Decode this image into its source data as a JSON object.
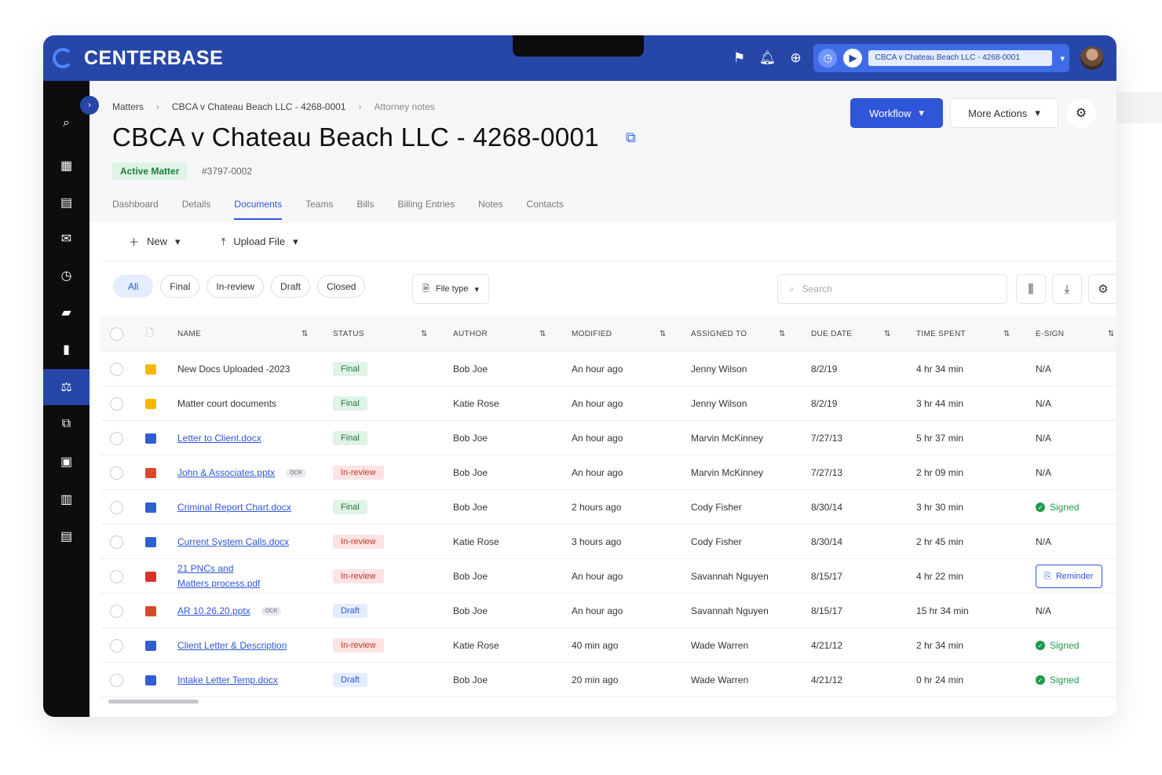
{
  "app": {
    "name": "CENTERBASE"
  },
  "topbar": {
    "icons": [
      "flag-icon",
      "bell-icon",
      "plus-circle-icon"
    ],
    "timer": {
      "matter_label": "CBCA v Chateau Beach LLC - 4268-0001"
    }
  },
  "sidebar": {
    "items": [
      "search-icon",
      "grid-icon",
      "calendar-icon",
      "mail-icon",
      "clock-icon",
      "folder-icon",
      "chart-icon",
      "scale-icon",
      "copy-icon",
      "book-icon",
      "clipboard-icon",
      "document-icon"
    ],
    "active": "scale-icon"
  },
  "breadcrumb": [
    "Matters",
    "CBCA v Chateau Beach LLC - 4268-0001",
    "Attorney notes"
  ],
  "page": {
    "title": "CBCA v Chateau Beach LLC - 4268-0001",
    "status": "Active Matter",
    "matter_id": "#3797-0002"
  },
  "actions": {
    "workflow": "Workflow",
    "more": "More Actions"
  },
  "tabs": [
    "Dashboard",
    "Details",
    "Documents",
    "Teams",
    "Bills",
    "Billing Entries",
    "Notes",
    "Contacts"
  ],
  "active_tab": "Documents",
  "toolbar": {
    "new": "New",
    "upload": "Upload File"
  },
  "filters": [
    "All",
    "Final",
    "In-review",
    "Draft",
    "Closed"
  ],
  "filetype": "File type",
  "search": {
    "placeholder": "Search"
  },
  "table": {
    "columns": [
      "NAME",
      "STATUS",
      "AUTHOR",
      "MODIFIED",
      "ASSIGNED TO",
      "DUE DATE",
      "TIME SPENT",
      "E-SIGN"
    ],
    "rows": [
      {
        "icon": "folder",
        "name": "New Docs Uploaded -2023",
        "link": false,
        "ocr": false,
        "status": "Final",
        "author": "Bob Joe",
        "modified": "An hour ago",
        "assigned": "Jenny Wilson",
        "due": "8/2/19",
        "time": "4 hr 34 min",
        "esign": "N/A"
      },
      {
        "icon": "folder",
        "name": "Matter court documents",
        "link": false,
        "ocr": false,
        "status": "Final",
        "author": "Katie Rose",
        "modified": "An hour ago",
        "assigned": "Jenny Wilson",
        "due": "8/2/19",
        "time": "3 hr 44 min",
        "esign": "N/A"
      },
      {
        "icon": "word",
        "name": "Letter to Client.docx",
        "link": true,
        "ocr": false,
        "status": "Final",
        "author": "Bob Joe",
        "modified": "An hour ago",
        "assigned": "Marvin McKinney",
        "due": "7/27/13",
        "time": "5 hr 37 min",
        "esign": "N/A"
      },
      {
        "icon": "ppt",
        "name": "John & Associates.pptx",
        "link": true,
        "ocr": true,
        "status": "In-review",
        "author": "Bob Joe",
        "modified": "An hour ago",
        "assigned": "Marvin McKinney",
        "due": "7/27/13",
        "time": "2 hr 09 min",
        "esign": "N/A"
      },
      {
        "icon": "word",
        "name": "Criminal Report Chart.docx",
        "link": true,
        "ocr": false,
        "status": "Final",
        "author": "Bob Joe",
        "modified": "2 hours ago",
        "assigned": "Cody Fisher",
        "due": "8/30/14",
        "time": "3 hr 30 min",
        "esign": "Signed"
      },
      {
        "icon": "word",
        "name": "Current System Calls.docx",
        "link": true,
        "ocr": false,
        "status": "In-review",
        "author": "Katie Rose",
        "modified": "3 hours ago",
        "assigned": "Cody Fisher",
        "due": "8/30/14",
        "time": "2 hr 45 min",
        "esign": "N/A"
      },
      {
        "icon": "pdf",
        "name": "21 PNCs and",
        "name2": "Matters process.pdf",
        "link": true,
        "ocr": false,
        "status": "In-review",
        "author": "Bob Joe",
        "modified": "An hour ago",
        "assigned": "Savannah Nguyen",
        "due": "8/15/17",
        "time": "4 hr 22 min",
        "esign": "Reminder"
      },
      {
        "icon": "ppt",
        "name": "AR 10.26.20.pptx",
        "link": true,
        "ocr": true,
        "status": "Draft",
        "author": "Bob Joe",
        "modified": "An hour ago",
        "assigned": "Savannah Nguyen",
        "due": "8/15/17",
        "time": "15 hr 34 min",
        "esign": "N/A"
      },
      {
        "icon": "word",
        "name": "Client Letter & Description",
        "link": true,
        "ocr": false,
        "status": "In-review",
        "author": "Katie Rose",
        "modified": "40 min ago",
        "assigned": "Wade Warren",
        "due": "4/21/12",
        "time": "2 hr 34 min",
        "esign": "Signed"
      },
      {
        "icon": "word",
        "name": "Intake Letter Temp.docx",
        "link": true,
        "ocr": false,
        "status": "Draft",
        "author": "Bob Joe",
        "modified": "20 min ago",
        "assigned": "Wade Warren",
        "due": "4/21/12",
        "time": "0 hr 24 min",
        "esign": "Signed"
      }
    ],
    "ocr_label": "OCR"
  },
  "colors": {
    "brand": "#2747a8",
    "accent": "#2f56d9",
    "sidebar": "#0d0d10"
  }
}
